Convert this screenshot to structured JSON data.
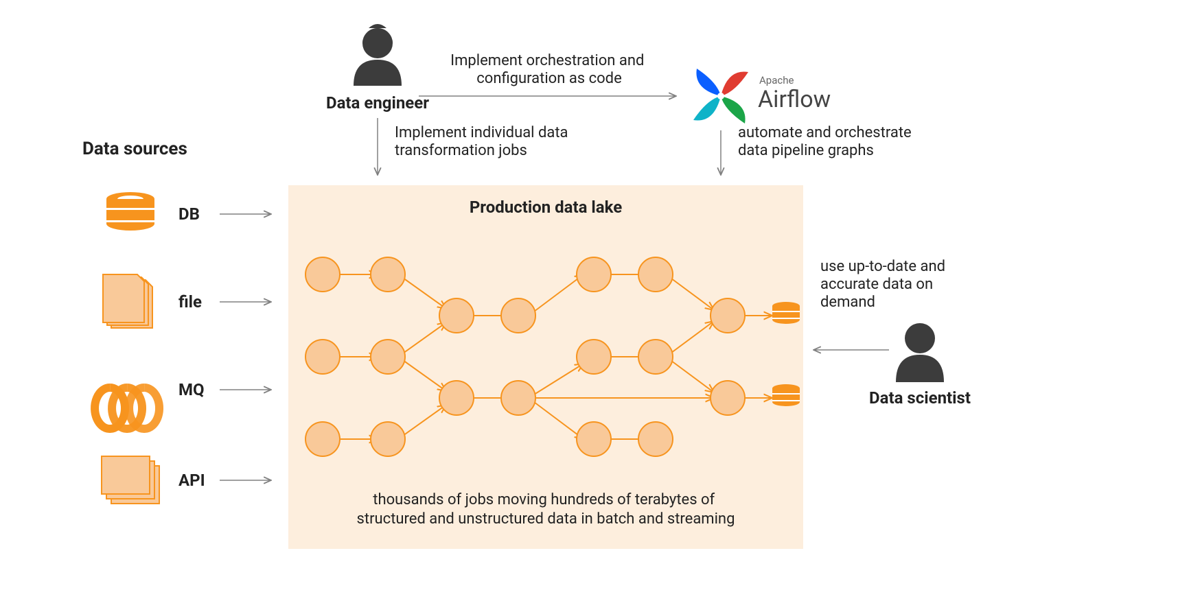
{
  "title_sources": "Data sources",
  "sources": [
    "DB",
    "file",
    "MQ",
    "API"
  ],
  "engineer_label": "Data engineer",
  "engineer_to_airflow": "Implement orchestration and configuration as code",
  "engineer_to_lake": "Implement individual data transformation jobs",
  "airflow_brand_top": "Apache",
  "airflow_brand_main": "Airflow",
  "airflow_to_lake": "automate and orchestrate data pipeline graphs",
  "lake_title": "Production data lake",
  "lake_caption": "thousands of jobs moving hundreds of terabytes of structured and unstructured data in batch and streaming",
  "scientist_label": "Data scientist",
  "scientist_caption": "use up-to-date and accurate data on demand",
  "colors": {
    "orange": "#F7941E",
    "orange_fill": "#F9C999",
    "lake_bg": "#FDEEDD",
    "gray": "#808080",
    "dark": "#3C3C3C",
    "text": "#222222"
  }
}
